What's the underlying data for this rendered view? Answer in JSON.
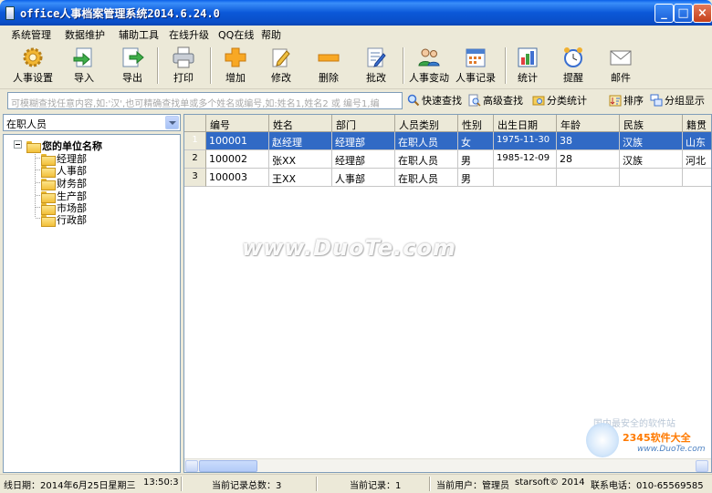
{
  "window": {
    "title": "office人事档案管理系统2014.6.24.0",
    "min_label": "_",
    "max_label": "□",
    "close_label": "×"
  },
  "menu": [
    "系统管理",
    "数据维护",
    "辅助工具",
    "在线升级",
    "QQ在线",
    "帮助"
  ],
  "toolbar": [
    {
      "label": "人事设置",
      "icon": "gear-icon"
    },
    {
      "label": "导入",
      "icon": "import-icon"
    },
    {
      "label": "导出",
      "icon": "export-icon"
    },
    {
      "label": "打印",
      "icon": "printer-icon"
    },
    {
      "label": "增加",
      "icon": "plus-icon"
    },
    {
      "label": "修改",
      "icon": "edit-icon"
    },
    {
      "label": "删除",
      "icon": "minus-icon"
    },
    {
      "label": "批改",
      "icon": "batch-edit-icon"
    },
    {
      "label": "人事变动",
      "icon": "people-icon"
    },
    {
      "label": "人事记录",
      "icon": "calendar-icon"
    },
    {
      "label": "统计",
      "icon": "chart-icon"
    },
    {
      "label": "提醒",
      "icon": "alarm-clock-icon"
    },
    {
      "label": "邮件",
      "icon": "mail-icon"
    }
  ],
  "search": {
    "placeholder": "可模糊查找任意内容,如:'汉',也可精确查找单或多个姓名或编号,如:姓名1,姓名2 或 编号1,编",
    "quick": "快速查找",
    "advanced": "高级查找",
    "category": "分类统计",
    "sort": "排序",
    "group": "分组显示"
  },
  "left": {
    "combo_value": "在职人员",
    "root": "您的单位名称",
    "departments": [
      "经理部",
      "人事部",
      "财务部",
      "生产部",
      "市场部",
      "行政部"
    ]
  },
  "grid": {
    "columns": [
      "编号",
      "姓名",
      "部门",
      "人员类别",
      "性别",
      "出生日期",
      "年龄",
      "民族",
      "籍贯"
    ],
    "rows": [
      {
        "no": "1",
        "cells": [
          "100001",
          "赵经理",
          "经理部",
          "在职人员",
          "女",
          "1975-11-30",
          "38",
          "汉族",
          "山东"
        ]
      },
      {
        "no": "2",
        "cells": [
          "100002",
          "张XX",
          "经理部",
          "在职人员",
          "男",
          "1985-12-09",
          "28",
          "汉族",
          "河北"
        ]
      },
      {
        "no": "3",
        "cells": [
          "100003",
          "王XX",
          "人事部",
          "在职人员",
          "男",
          "",
          "",
          "",
          ""
        ]
      }
    ]
  },
  "watermark": {
    "main": "www.DuoTe.com",
    "brand": "2345软件大全",
    "url": "www.DuoTe.com",
    "slogan": "国内最安全的软件站"
  },
  "status": {
    "date": "线日期：2014年6月25日星期三",
    "time": "13:50:3",
    "total": "当前记录总数：3",
    "current": "当前记录：1",
    "user": "当前用户：管理员",
    "copyright": "starsoft© 2014",
    "phone": "联系电话：010-65569585"
  },
  "colors": {
    "selection": "#316ac5",
    "titlebar": "#0a58d8"
  }
}
